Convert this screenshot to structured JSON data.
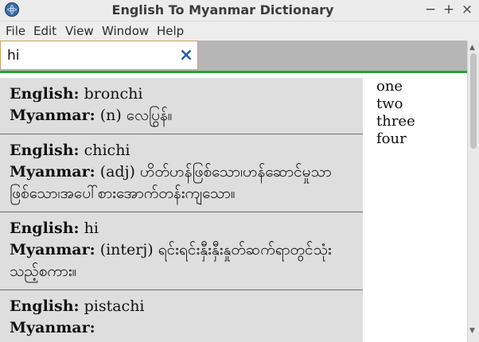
{
  "window": {
    "title": "English To Myanmar Dictionary",
    "app_icon": "globe-icon",
    "min": "−",
    "max": "+",
    "close": "×"
  },
  "menu": {
    "file": "File",
    "edit": "Edit",
    "view": "View",
    "window": "Window",
    "help": "Help"
  },
  "search": {
    "value": "hi",
    "placeholder": "",
    "clear": "×"
  },
  "labels": {
    "english": "English:",
    "myanmar": "Myanmar:"
  },
  "results": [
    {
      "english": "bronchi",
      "myanmar": "(n) လေပြွန်။"
    },
    {
      "english": "chichi",
      "myanmar": "(adj) ဟိတ်ဟန်ဖြစ်သော၊ဟန်ဆောင်မှုသာ ဖြစ်သော၊အပေါ်စားအောက်တန်းကျသော။"
    },
    {
      "english": "hi",
      "myanmar": "(interj) ရင်းရင်းနှီးနှီးနှုတ်ဆက်ရာတွင်သုံး သည့်စကား။"
    },
    {
      "english": "pistachi",
      "myanmar": ""
    }
  ],
  "side_list": [
    "one",
    "two",
    "three",
    "four"
  ],
  "colors": {
    "accent_line": "#20a339",
    "clear_icon": "#2f5e9e",
    "card_bg": "#dedede"
  },
  "scrollbar": {
    "up": "▲",
    "down": "▼"
  }
}
